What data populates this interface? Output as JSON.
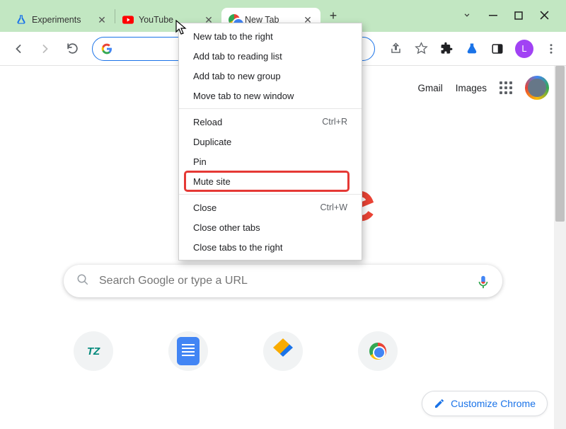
{
  "tabs": [
    {
      "label": "Experiments",
      "icon": "flask"
    },
    {
      "label": "YouTube",
      "icon": "youtube"
    },
    {
      "label": "New Tab",
      "icon": "chrome"
    }
  ],
  "toolbar": {
    "omnibox_value": "",
    "omnibox_placeholder": ""
  },
  "ntp": {
    "gmail": "Gmail",
    "images": "Images",
    "search_placeholder": "Search Google or type a URL",
    "customize_label": "Customize Chrome"
  },
  "profile_initial": "L",
  "ctx_highlight_index": 7,
  "context_menu": [
    {
      "label": "New tab to the right",
      "shortcut": ""
    },
    {
      "label": "Add tab to reading list",
      "shortcut": ""
    },
    {
      "label": "Add tab to new group",
      "shortcut": ""
    },
    {
      "label": "Move tab to new window",
      "shortcut": ""
    },
    {
      "sep": true
    },
    {
      "label": "Reload",
      "shortcut": "Ctrl+R"
    },
    {
      "label": "Duplicate",
      "shortcut": ""
    },
    {
      "label": "Pin",
      "shortcut": ""
    },
    {
      "label": "Mute site",
      "shortcut": ""
    },
    {
      "sep": true
    },
    {
      "label": "Close",
      "shortcut": "Ctrl+W"
    },
    {
      "label": "Close other tabs",
      "shortcut": ""
    },
    {
      "label": "Close tabs to the right",
      "shortcut": ""
    }
  ]
}
